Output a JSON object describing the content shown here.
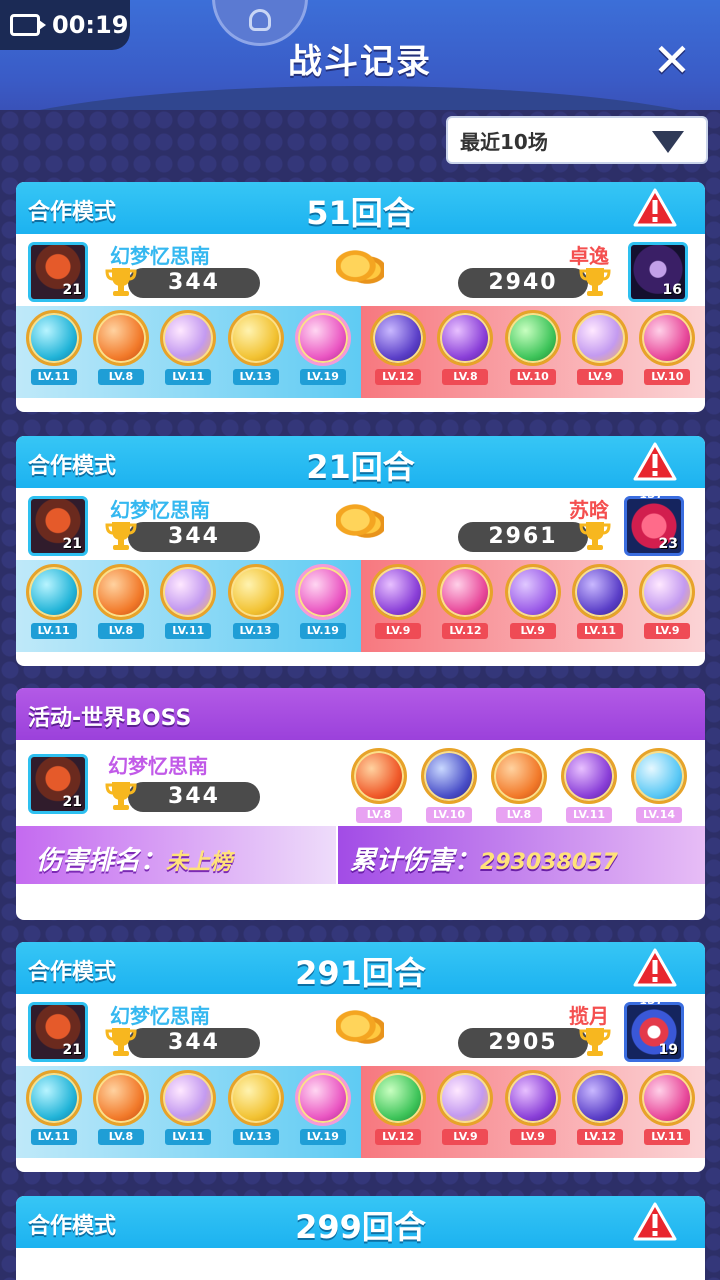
{
  "status": {
    "record_time": "00:19"
  },
  "header": {
    "title": "战斗记录",
    "close_label": "✕"
  },
  "filter": {
    "selected": "最近10场"
  },
  "colors": {
    "coop_head": "#1cb2f0",
    "boss_head": "#9b41db",
    "my_name": "#35b8f0",
    "opp_name": "#f44f4f"
  },
  "cards": [
    {
      "mode": "合作模式",
      "rounds": "51回合",
      "me": {
        "name": "幻梦忆思南",
        "level": "21",
        "score": "344"
      },
      "opp": {
        "name": "卓逸",
        "level": "16",
        "score": "2940"
      },
      "my_pets": [
        "LV.11",
        "LV.8",
        "LV.11",
        "LV.13",
        "LV.19"
      ],
      "opp_pets": [
        "LV.12",
        "LV.8",
        "LV.10",
        "LV.9",
        "LV.10"
      ]
    },
    {
      "mode": "合作模式",
      "rounds": "21回合",
      "me": {
        "name": "幻梦忆思南",
        "level": "21",
        "score": "344"
      },
      "opp": {
        "name": "苏晗",
        "level": "23",
        "score": "2961",
        "badge": "1ST"
      },
      "my_pets": [
        "LV.11",
        "LV.8",
        "LV.11",
        "LV.13",
        "LV.19"
      ],
      "opp_pets": [
        "LV.9",
        "LV.12",
        "LV.9",
        "LV.11",
        "LV.9"
      ]
    },
    {
      "mode": "合作模式",
      "rounds": "291回合",
      "me": {
        "name": "幻梦忆思南",
        "level": "21",
        "score": "344"
      },
      "opp": {
        "name": "揽月",
        "level": "19",
        "score": "2905",
        "badge": "1ST"
      },
      "my_pets": [
        "LV.11",
        "LV.8",
        "LV.11",
        "LV.13",
        "LV.19"
      ],
      "opp_pets": [
        "LV.12",
        "LV.9",
        "LV.9",
        "LV.12",
        "LV.11"
      ]
    },
    {
      "mode": "合作模式",
      "rounds": "299回合"
    }
  ],
  "boss": {
    "mode": "活动-世界BOSS",
    "me": {
      "name": "幻梦忆思南",
      "level": "21",
      "score": "344"
    },
    "pets": [
      "LV.8",
      "LV.10",
      "LV.8",
      "LV.11",
      "LV.14"
    ],
    "rank_label": "伤害排名：",
    "rank_value": "未上榜",
    "total_label": "累计伤害：",
    "total_value": "293038057"
  }
}
